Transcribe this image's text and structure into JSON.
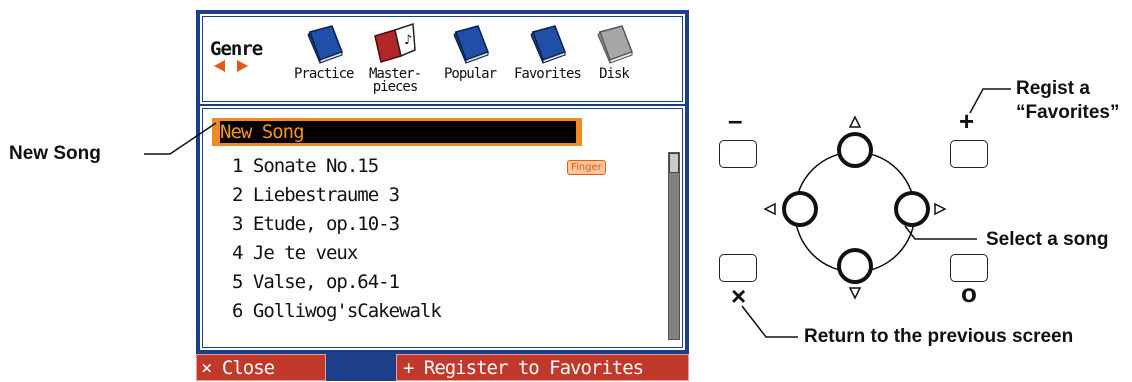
{
  "screen": {
    "genre_label": "Genre",
    "genres": [
      {
        "label": "Practice",
        "icon": "practice-book-icon",
        "color": "#1f4fa8"
      },
      {
        "label": "Master-\npieces",
        "icon": "masterpieces-book-icon",
        "color": "#b3262a"
      },
      {
        "label": "Popular",
        "icon": "popular-book-icon",
        "color": "#1f4fa8"
      },
      {
        "label": "Favorites",
        "icon": "favorites-book-icon",
        "color": "#1f4fa8"
      },
      {
        "label": "Disk",
        "icon": "disk-book-icon",
        "color": "#9a9a9a"
      }
    ],
    "new_song": "New Song",
    "songs": [
      "1  Sonate No.15",
      "2  Liebestraume 3",
      "3  Etude, op.10-3",
      "4  Je te veux",
      "5  Valse, op.64-1",
      "6  Golliwog'sCakewalk"
    ],
    "finger_badge": "Finger",
    "close_button": "× Close",
    "register_button": "+ Register to Favorites"
  },
  "callouts": {
    "new_song": "New Song",
    "regist_line1": "Regist a",
    "regist_line2": "“Favorites”",
    "select_song": "Select a song",
    "return_screen": "Return to the previous screen"
  },
  "keys": {
    "minus": "–",
    "plus": "+",
    "x": "×",
    "o": "o"
  },
  "colors": {
    "screen_frame": "#1d3f8a",
    "highlight": "#f08a24",
    "button_red": "#c0392b",
    "arrow_orange": "#e05a1c"
  }
}
